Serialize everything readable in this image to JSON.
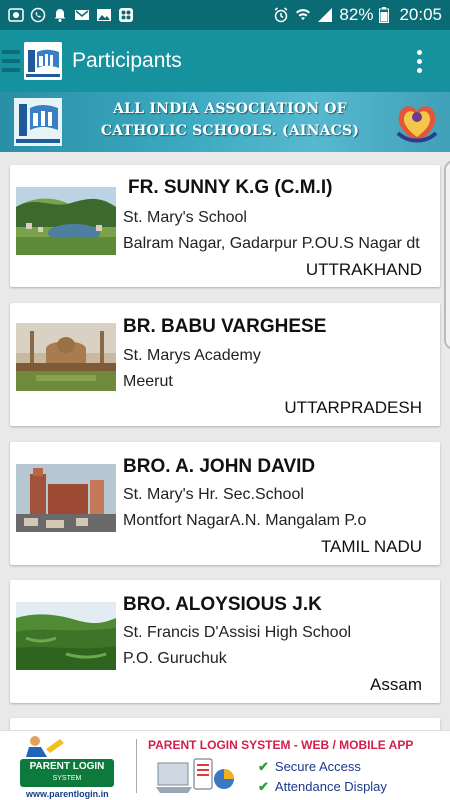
{
  "status_bar": {
    "battery": "82%",
    "time": "20:05"
  },
  "app_bar": {
    "title": "Participants"
  },
  "banner": {
    "line1": "ALL INDIA ASSOCIATION OF",
    "line2": "CATHOLIC SCHOOLS. (AINACS)"
  },
  "participants": [
    {
      "name": "FR. SUNNY K.G (C.M.I)",
      "school": "St. Mary's School",
      "address": "Balram Nagar, Gadarpur P.OU.S Nagar dt",
      "state": "UTTRAKHAND"
    },
    {
      "name": "BR. BABU VARGHESE",
      "school": "St. Marys Academy",
      "address": "Meerut",
      "state": "UTTARPRADESH"
    },
    {
      "name": "BRO. A. JOHN DAVID",
      "school": "St. Mary's Hr. Sec.School",
      "address": "Montfort NagarA.N. Mangalam P.o",
      "state": "TAMIL NADU"
    },
    {
      "name": "BRO. ALOYSIOUS J.K",
      "school": "St. Francis D'Assisi High School",
      "address": "P.O. Guruchuk",
      "state": "Assam"
    }
  ],
  "ad": {
    "brand_line1": "PARENT LOGIN",
    "brand_line2": "SYSTEM",
    "url": "www.parentlogin.in",
    "headline": "PARENT LOGIN SYSTEM -  WEB / MOBILE APP",
    "feature1": "Secure Access",
    "feature2": "Attendance Display"
  },
  "colors": {
    "status_bar": "#0b6b75",
    "app_bar": "#16929e",
    "background": "#e9e9e9"
  }
}
